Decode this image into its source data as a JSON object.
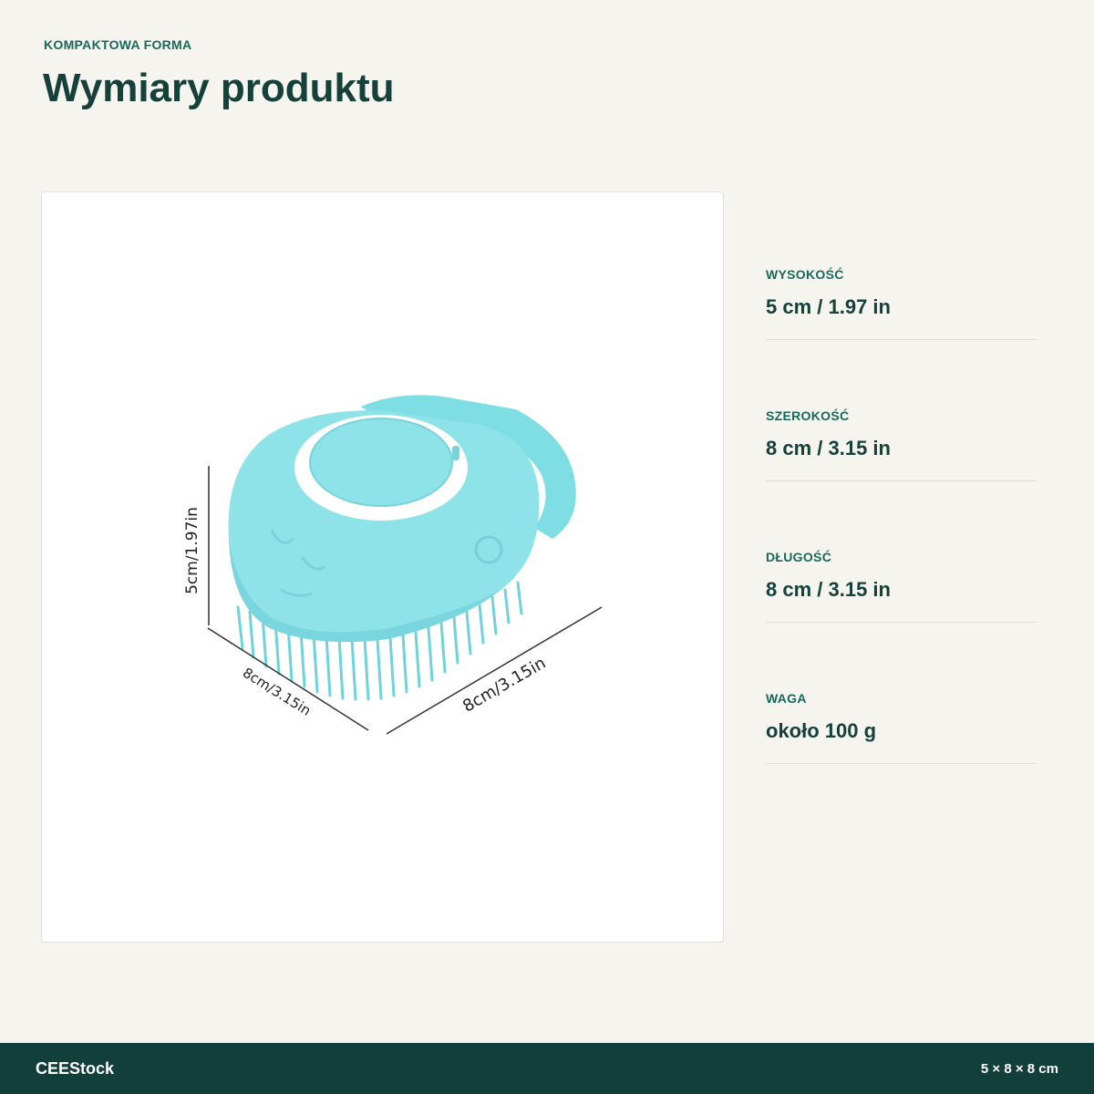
{
  "header": {
    "eyebrow": "KOMPAKTOWA FORMA",
    "title": "Wymiary produktu"
  },
  "image": {
    "subject": "silicone bath brush with shampoo dispenser",
    "product_color": "#8ee3e8",
    "height_label": "5cm/1.97in",
    "width_label": "8cm/3.15in",
    "length_label": "8cm/3.15in"
  },
  "specs": [
    {
      "label": "WYSOKOŚĆ",
      "value": "5 cm / 1.97 in"
    },
    {
      "label": "SZEROKOŚĆ",
      "value": "8 cm / 3.15 in"
    },
    {
      "label": "DŁUGOŚĆ",
      "value": "8 cm / 3.15 in"
    },
    {
      "label": "WAGA",
      "value": "około 100 g"
    }
  ],
  "footer": {
    "brand": "CEEStock",
    "dimensions": "5 × 8 × 8 cm"
  },
  "colors": {
    "background": "#f5f4ef",
    "accent": "#18695a",
    "heading": "#16403a",
    "footer": "#123f3a"
  }
}
